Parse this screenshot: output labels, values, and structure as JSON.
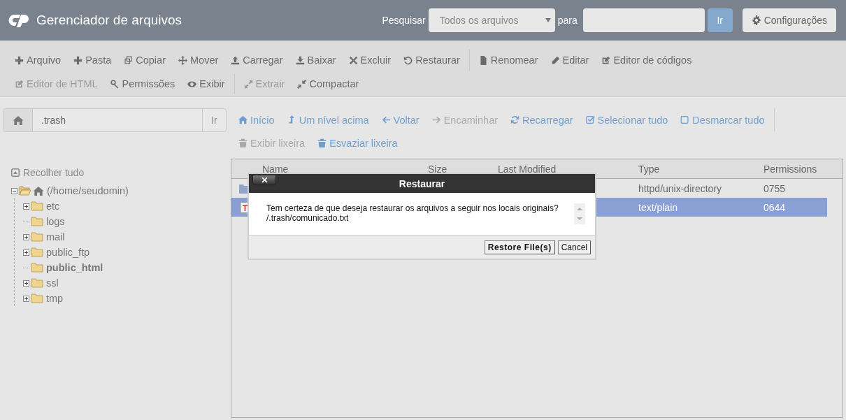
{
  "header": {
    "title": "Gerenciador de arquivos",
    "search_label": "Pesquisar",
    "search_scope": "Todos os arquivos",
    "for_label": "para",
    "search_button": "Ir",
    "settings_button": "Configurações"
  },
  "toolbar": {
    "lines": [
      {
        "groups": [
          {
            "items": [
              {
                "label": "Arquivo",
                "disabled": false
              },
              {
                "label": "Pasta",
                "disabled": false
              },
              {
                "label": "Copiar",
                "disabled": false
              },
              {
                "label": "Mover",
                "disabled": false
              },
              {
                "label": "Carregar",
                "disabled": false
              },
              {
                "label": "Baixar",
                "disabled": false
              },
              {
                "label": "Excluir",
                "disabled": false
              },
              {
                "label": "Restaurar",
                "disabled": false
              }
            ]
          },
          {
            "items": [
              {
                "label": "Renomear",
                "disabled": false
              },
              {
                "label": "Editar",
                "disabled": false
              },
              {
                "label": "Editor de códigos",
                "disabled": false
              }
            ]
          }
        ]
      },
      {
        "groups": [
          {
            "items": [
              {
                "label": "Editor de HTML",
                "disabled": true
              },
              {
                "label": "Permissões",
                "disabled": false
              },
              {
                "label": "Exibir",
                "disabled": false
              }
            ]
          },
          {
            "items": [
              {
                "label": "Extrair",
                "disabled": true
              },
              {
                "label": "Compactar",
                "disabled": false
              }
            ]
          }
        ]
      }
    ]
  },
  "path_bar": {
    "value": ".trash",
    "go_button": "Ir"
  },
  "collapse_all": "Recolher tudo",
  "tree": [
    {
      "label": "(/home/seudomin)",
      "expanded": true,
      "selected": false,
      "children": [
        {
          "label": "etc",
          "expanded": false,
          "selected": false
        },
        {
          "label": "logs",
          "selected": false
        },
        {
          "label": "mail",
          "expanded": false,
          "selected": false
        },
        {
          "label": "public_ftp",
          "expanded": false,
          "selected": false
        },
        {
          "label": "public_html",
          "selected": true
        },
        {
          "label": "ssl",
          "expanded": false,
          "selected": false
        },
        {
          "label": "tmp",
          "expanded": false,
          "selected": false
        }
      ]
    }
  ],
  "nav": {
    "lines": [
      {
        "trailing_divider": true,
        "items": [
          {
            "label": "Início",
            "disabled": false
          },
          {
            "label": "Um nível acima",
            "disabled": false
          },
          {
            "label": "Voltar",
            "disabled": false
          },
          {
            "label": "Encaminhar",
            "disabled": true
          },
          {
            "label": "Recarregar",
            "disabled": false
          },
          {
            "label": "Selecionar tudo",
            "disabled": false
          },
          {
            "label": "Desmarcar tudo",
            "disabled": false
          }
        ]
      },
      {
        "items": [
          {
            "label": "Exibir lixeira",
            "disabled": true
          },
          {
            "label": "Esvaziar lixeira",
            "disabled": false
          }
        ]
      }
    ]
  },
  "table": {
    "columns": [
      "Name",
      "Size",
      "Last Modified",
      "Type",
      "Permissions"
    ],
    "rows": [
      {
        "kind": "folder",
        "type": "httpd/unix-directory",
        "permissions": "0755",
        "selected": false
      },
      {
        "kind": "text",
        "type": "text/plain",
        "permissions": "0644",
        "selected": true
      }
    ]
  },
  "dialog": {
    "title": "Restaurar",
    "message": "Tem certeza de que deseja restaurar os arquivos a seguir nos locais originais?",
    "files": [
      "/.trash/comunicado.txt"
    ],
    "buttons": [
      {
        "label": "Restore File(s)",
        "kind": "primary"
      },
      {
        "label": "Cancel",
        "kind": "secondary"
      }
    ]
  }
}
